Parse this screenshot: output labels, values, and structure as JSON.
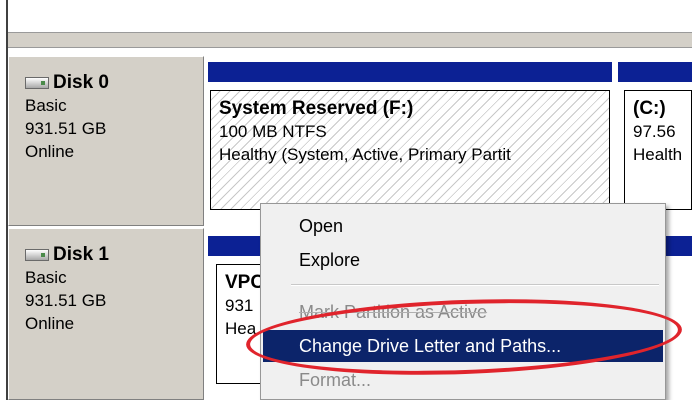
{
  "disks": [
    {
      "title": "Disk 0",
      "type": "Basic",
      "size": "931.51 GB",
      "status": "Online"
    },
    {
      "title": "Disk 1",
      "type": "Basic",
      "size": "931.51 GB",
      "status": "Online"
    }
  ],
  "partitions": {
    "disk0": [
      {
        "name": "System Reserved  (F:)",
        "fs": "100 MB NTFS",
        "health": "Healthy (System, Active, Primary Partit"
      },
      {
        "name": "(C:)",
        "fs": "97.56",
        "health": "Health"
      }
    ],
    "disk1": [
      {
        "name": "VPC",
        "fs": "931",
        "health": "Hea"
      }
    ]
  },
  "context_menu": {
    "items": [
      {
        "label": "Open",
        "state": "enabled"
      },
      {
        "label": "Explore",
        "state": "enabled"
      },
      {
        "label": "Mark Partition as Active",
        "state": "disabled"
      },
      {
        "label": "Change Drive Letter and Paths...",
        "state": "highlighted"
      },
      {
        "label": "Format...",
        "state": "disabled"
      }
    ]
  },
  "colors": {
    "partition_header": "#0c2194",
    "menu_highlight": "#0c246a",
    "annotation_ellipse": "#e0242c"
  }
}
